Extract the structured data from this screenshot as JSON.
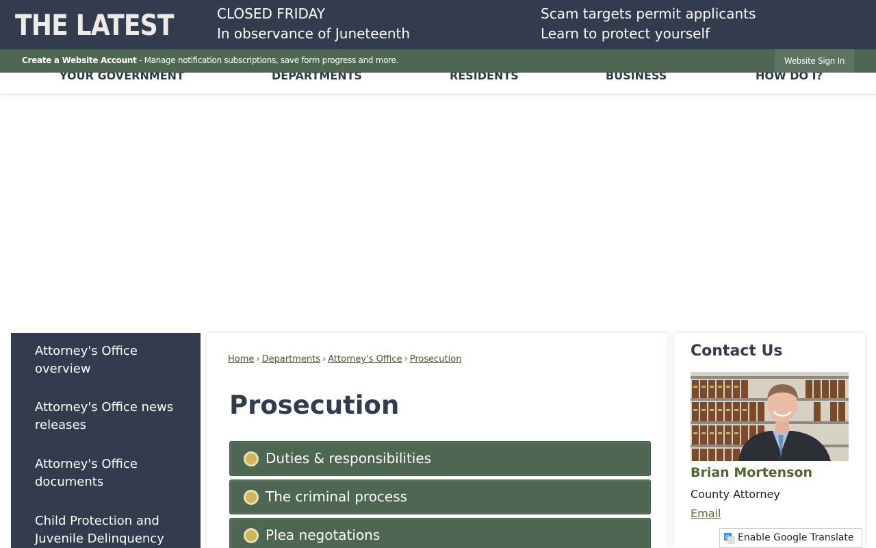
{
  "header": {
    "brand": "THE LATEST",
    "news": [
      {
        "line1": "CLOSED FRIDAY",
        "line2": "In observance of Juneteenth"
      },
      {
        "line1": "Scam targets permit applicants",
        "line2": "Learn to protect yourself"
      }
    ]
  },
  "account_bar": {
    "create_label": "Create a Website Account",
    "description": " - Manage notification subscriptions, save form progress and more.",
    "sign_in": "Website Sign In"
  },
  "nav": {
    "items": [
      "YOUR GOVERNMENT",
      "DEPARTMENTS",
      "RESIDENTS",
      "BUSINESS",
      "HOW DO I?"
    ]
  },
  "sidebar": {
    "items": [
      "Attorney's Office overview",
      "Attorney's Office news releases",
      "Attorney's Office documents",
      "Child Protection and Juvenile Delinquency"
    ]
  },
  "breadcrumb": {
    "items": [
      "Home",
      "Departments",
      "Attorney's Office",
      "Prosecution"
    ],
    "separator": "›"
  },
  "main": {
    "title": "Prosecution",
    "accordions": [
      "Duties & responsibilities",
      "The criminal process",
      "Plea negotations"
    ]
  },
  "contact": {
    "title": "Contact Us",
    "name": "Brian Mortenson",
    "role": "County Attorney",
    "email_label": "Email"
  },
  "translate": {
    "label": "Enable Google Translate"
  },
  "colors": {
    "dark_navy": "#323c4e",
    "green": "#4d6753",
    "accent_gold": "#cdb55a"
  }
}
